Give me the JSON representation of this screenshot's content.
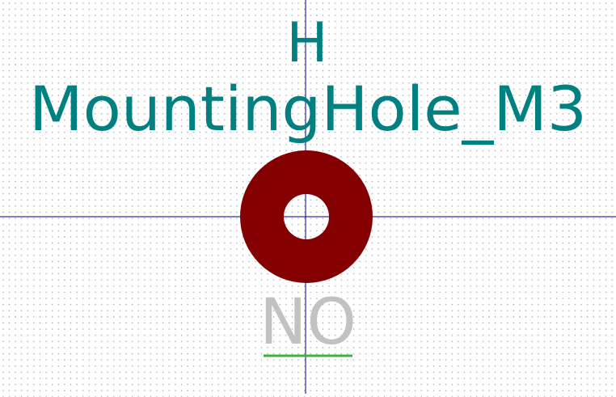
{
  "footprint": {
    "reference": "H",
    "value": "MountingHole_M3",
    "pad_number": "NO"
  },
  "colors": {
    "background": "#ffffff",
    "grid_dot": "#a6a6a6",
    "crosshair": "#000080",
    "reference_text": "#008080",
    "value_text": "#008080",
    "pad_copper": "#840000",
    "pad_text": "#c2c2c2",
    "underline": "#3cb33c"
  }
}
